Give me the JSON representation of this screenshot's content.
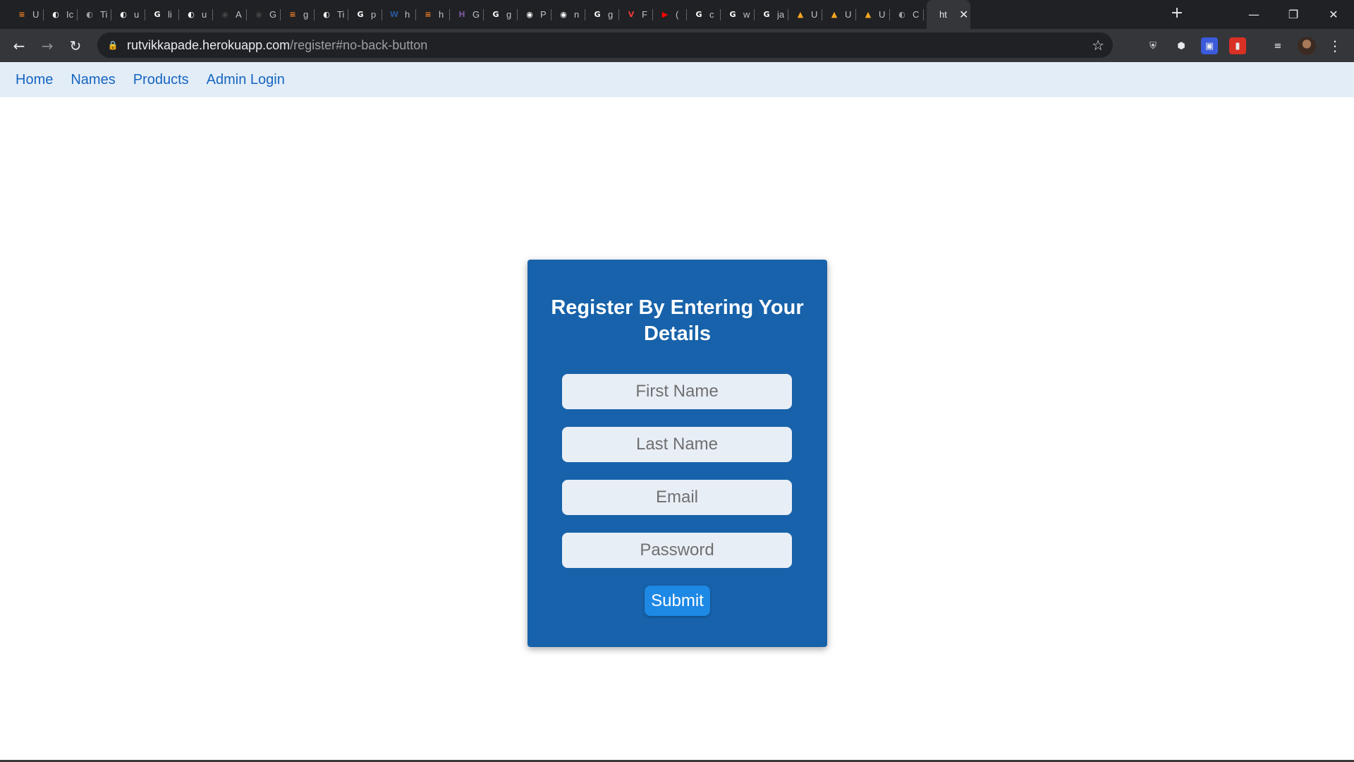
{
  "browser": {
    "tabs": [
      {
        "icon": "stackoverflow-icon",
        "color": "#f48024",
        "glyph": "≡",
        "title": "U"
      },
      {
        "icon": "globe-icon",
        "color": "#ffffff",
        "glyph": "◐",
        "title": "Ic"
      },
      {
        "icon": "globe-icon",
        "color": "#9aa0a6",
        "glyph": "◐",
        "title": "Ti"
      },
      {
        "icon": "globe-icon",
        "color": "#ffffff",
        "glyph": "◐",
        "title": "u"
      },
      {
        "icon": "google-icon",
        "color": "#ffffff",
        "glyph": "G",
        "title": "li"
      },
      {
        "icon": "globe-icon",
        "color": "#ffffff",
        "glyph": "◐",
        "title": "u"
      },
      {
        "icon": "github-icon",
        "color": "#444444",
        "glyph": "◉",
        "title": "A"
      },
      {
        "icon": "github-icon",
        "color": "#444444",
        "glyph": "◉",
        "title": "G"
      },
      {
        "icon": "stackoverflow-icon",
        "color": "#f48024",
        "glyph": "≡",
        "title": "g"
      },
      {
        "icon": "globe-icon",
        "color": "#ffffff",
        "glyph": "◐",
        "title": "Ti"
      },
      {
        "icon": "google-icon",
        "color": "#ffffff",
        "glyph": "G",
        "title": "p"
      },
      {
        "icon": "word-icon",
        "color": "#2b579a",
        "glyph": "W",
        "title": "h"
      },
      {
        "icon": "stackoverflow-icon",
        "color": "#f48024",
        "glyph": "≡",
        "title": "h"
      },
      {
        "icon": "heroku-icon",
        "color": "#79589f",
        "glyph": "H",
        "title": "G"
      },
      {
        "icon": "google-icon",
        "color": "#ffffff",
        "glyph": "G",
        "title": "g"
      },
      {
        "icon": "github-icon",
        "color": "#ffffff",
        "glyph": "◉",
        "title": "P"
      },
      {
        "icon": "github-icon",
        "color": "#ffffff",
        "glyph": "◉",
        "title": "n"
      },
      {
        "icon": "google-icon",
        "color": "#ffffff",
        "glyph": "G",
        "title": "g"
      },
      {
        "icon": "vivaldi-icon",
        "color": "#ef3939",
        "glyph": "V",
        "title": "F"
      },
      {
        "icon": "youtube-icon",
        "color": "#ff0000",
        "glyph": "▶",
        "title": "("
      },
      {
        "icon": "google-icon",
        "color": "#ffffff",
        "glyph": "G",
        "title": "c"
      },
      {
        "icon": "google-icon",
        "color": "#ffffff",
        "glyph": "G",
        "title": "w"
      },
      {
        "icon": "google-icon",
        "color": "#ffffff",
        "glyph": "G",
        "title": "ja"
      },
      {
        "icon": "udemy-icon",
        "color": "#f5a623",
        "glyph": "▲",
        "title": "U"
      },
      {
        "icon": "udemy-icon",
        "color": "#f5a623",
        "glyph": "▲",
        "title": "U"
      },
      {
        "icon": "udemy-icon",
        "color": "#f5a623",
        "glyph": "▲",
        "title": "U"
      },
      {
        "icon": "globe-icon",
        "color": "#9aa0a6",
        "glyph": "◐",
        "title": "C"
      }
    ],
    "active_tab": {
      "title": "ht",
      "close": "✕"
    },
    "new_tab": "+",
    "window": {
      "minimize": "—",
      "restore": "❐",
      "close": "✕"
    },
    "nav": {
      "back": "←",
      "forward": "→",
      "reload": "↻"
    },
    "url_host": "rutvikkapade.herokuapp.com",
    "url_path": "/register#no-back-button",
    "lock": "🔒",
    "star": "☆",
    "extensions": [
      {
        "icon": "shield-icon",
        "glyph": "⛨",
        "bg": "transparent"
      },
      {
        "icon": "cube-icon",
        "glyph": "⬢",
        "bg": "transparent"
      },
      {
        "icon": "screen-icon",
        "glyph": "▣",
        "bg": "#3b5bdb"
      },
      {
        "icon": "bookmark-ext-icon",
        "glyph": "▮",
        "bg": "#d93025"
      },
      {
        "icon": "media-control-icon",
        "glyph": "≡",
        "bg": "transparent"
      }
    ],
    "menu": "⋮"
  },
  "site": {
    "nav": [
      "Home",
      "Names",
      "Products",
      "Admin Login"
    ]
  },
  "form": {
    "title": "Register By Entering Your Details",
    "first_name_placeholder": "First Name",
    "last_name_placeholder": "Last Name",
    "email_placeholder": "Email",
    "password_placeholder": "Password",
    "submit_label": "Submit"
  },
  "colors": {
    "card": "#1762aa",
    "nav_link": "#1565c0",
    "submit": "#1e88e5"
  }
}
